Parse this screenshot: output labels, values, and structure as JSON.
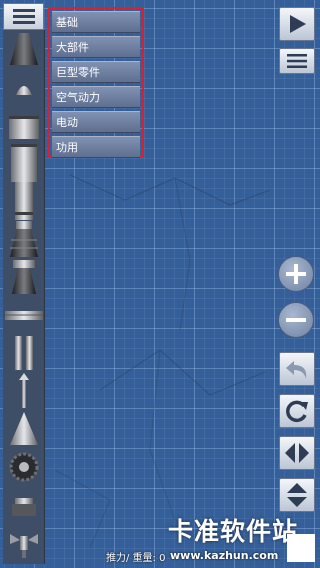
{
  "toolbar": {
    "menu_icon": "hamburger-icon",
    "play_icon": "play-icon",
    "options_icon": "hamburger-icon"
  },
  "categories": [
    {
      "label": "基础"
    },
    {
      "label": "大部件"
    },
    {
      "label": "巨型零件"
    },
    {
      "label": "空气动力"
    },
    {
      "label": "电动"
    },
    {
      "label": "功用"
    }
  ],
  "parts": [
    {
      "name": "engine-nozzle-part"
    },
    {
      "name": "nose-cap-part"
    },
    {
      "name": "fuel-tank-part"
    },
    {
      "name": "large-fuel-tank-part"
    },
    {
      "name": "tall-fuel-tank-part"
    },
    {
      "name": "large-engine-part"
    },
    {
      "name": "engine-part"
    },
    {
      "name": "separator-part"
    },
    {
      "name": "side-tank-part"
    },
    {
      "name": "strut-part"
    },
    {
      "name": "nose-cone-part"
    },
    {
      "name": "wheel-part"
    },
    {
      "name": "docking-port-part"
    },
    {
      "name": "satellite-part"
    }
  ],
  "controls": {
    "zoom_in_icon": "plus-icon",
    "zoom_out_icon": "minus-icon",
    "undo_icon": "undo-icon",
    "rotate_icon": "rotate-icon",
    "flip_h_icon": "flip-horizontal-icon",
    "flip_v_icon": "flip-vertical-icon"
  },
  "status": {
    "text": "推力/ 重量: 0"
  },
  "watermark": {
    "brand": "卡准软件站",
    "url": "www.kazhun.com"
  },
  "colors": {
    "background": "#355f98",
    "highlight_border": "#d8202e",
    "panel": "#3e4e66"
  }
}
